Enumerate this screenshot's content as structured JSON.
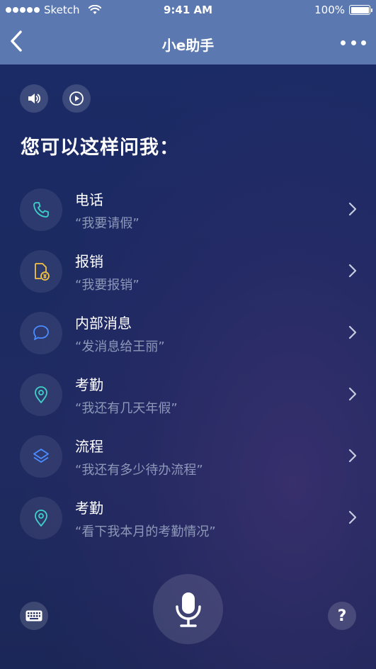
{
  "status_bar": {
    "carrier": "Sketch",
    "time": "9:41 AM",
    "battery": "100%"
  },
  "nav": {
    "title": "小e助手",
    "back_icon": "chevron-left-icon",
    "more_icon": "more-horizontal-icon"
  },
  "controls": {
    "speaker_icon": "speaker-icon",
    "play_icon": "play-circle-icon"
  },
  "heading": "您可以这样问我：",
  "items": [
    {
      "label": "电话",
      "example": "“我要请假”",
      "icon": "phone-icon",
      "color": "#3fd0c9"
    },
    {
      "label": "报销",
      "example": "“我要报销”",
      "icon": "receipt-yen-icon",
      "color": "#f4c242"
    },
    {
      "label": "内部消息",
      "example": "“发消息给王丽”",
      "icon": "chat-bubble-icon",
      "color": "#4a8cff"
    },
    {
      "label": "考勤",
      "example": "“我还有几天年假”",
      "icon": "location-pin-icon",
      "color": "#3fd0c9"
    },
    {
      "label": "流程",
      "example": "“我还有多少待办流程”",
      "icon": "layers-icon",
      "color": "#4a8cff"
    },
    {
      "label": "考勤",
      "example": "“看下我本月的考勤情况”",
      "icon": "location-pin-icon",
      "color": "#3fd0c9"
    }
  ],
  "bottom": {
    "keyboard_icon": "keyboard-icon",
    "mic_icon": "microphone-icon",
    "help_label": "?"
  },
  "colors": {
    "nav_bg": "#5b79b0",
    "page_bg": "#1c2a62",
    "teal": "#3fd0c9",
    "yellow": "#f4c242",
    "blue": "#4a8cff",
    "muted_text": "#8e98b8"
  }
}
